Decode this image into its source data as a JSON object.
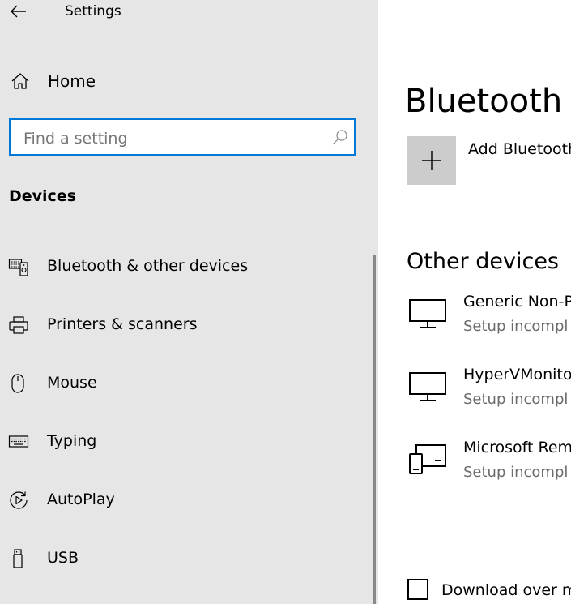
{
  "app": {
    "title": "Settings"
  },
  "sidebar": {
    "home_label": "Home",
    "search": {
      "placeholder": "Find a setting",
      "value": ""
    },
    "section_title": "Devices",
    "items": [
      {
        "label": "Bluetooth & other devices",
        "icon": "bluetooth-devices-icon"
      },
      {
        "label": "Printers & scanners",
        "icon": "printer-icon"
      },
      {
        "label": "Mouse",
        "icon": "mouse-icon"
      },
      {
        "label": "Typing",
        "icon": "keyboard-icon"
      },
      {
        "label": "AutoPlay",
        "icon": "autoplay-icon"
      },
      {
        "label": "USB",
        "icon": "usb-icon"
      }
    ]
  },
  "main": {
    "page_title": "Bluetooth &",
    "add_label": "Add Bluetooth",
    "other_devices_title": "Other devices",
    "devices": [
      {
        "name": "Generic Non-P",
        "status": "Setup incompl",
        "icon": "monitor-icon"
      },
      {
        "name": "HyperVMonito",
        "status": "Setup incompl",
        "icon": "monitor-icon"
      },
      {
        "name": "Microsoft Rem",
        "status": "Setup incompl",
        "icon": "remote-devices-icon"
      }
    ],
    "metered_label": "Download over m",
    "metered_checked": false
  },
  "colors": {
    "sidebar_bg": "#e6e6e6",
    "accent": "#0078d7",
    "tile_bg": "#cccccc",
    "secondary_text": "#6b6b6b"
  }
}
